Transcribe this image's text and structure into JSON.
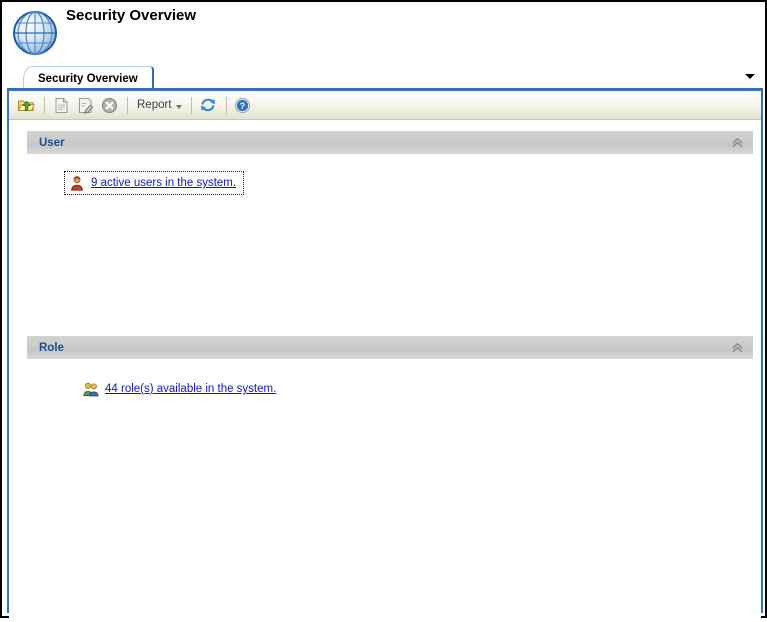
{
  "window": {
    "title": "Security Overview",
    "logo_icon": "globe-icon"
  },
  "tabs": [
    {
      "label": "Security Overview",
      "active": true
    }
  ],
  "tab_strip": {
    "overflow_icon": "chevron-down-icon"
  },
  "toolbar": {
    "buttons": [
      {
        "name": "go-up-button",
        "icon": "folder-up-arrow-icon",
        "label": "",
        "enabled": true
      },
      {
        "name": "new-button",
        "icon": "new-document-icon",
        "label": "",
        "enabled": false
      },
      {
        "name": "edit-button",
        "icon": "edit-document-icon",
        "label": "",
        "enabled": false
      },
      {
        "name": "delete-button",
        "icon": "delete-circle-icon",
        "label": "",
        "enabled": false
      }
    ],
    "report_menu": {
      "label": "Report",
      "caret_icon": "caret-down-icon"
    },
    "refresh_button": {
      "label": "",
      "icon": "refresh-icon"
    },
    "help_button": {
      "label": "",
      "icon": "help-question-icon"
    }
  },
  "sections": [
    {
      "id": "user",
      "title": "User",
      "collapse_icon": "double-chevron-up-icon",
      "item": {
        "icon": "single-user-icon",
        "text": "9 active users in the system.",
        "focused": true
      }
    },
    {
      "id": "role",
      "title": "Role",
      "collapse_icon": "double-chevron-up-icon",
      "item": {
        "icon": "user-group-icon",
        "text": "44 role(s) available in the system.",
        "focused": false
      }
    }
  ],
  "colors": {
    "frame": "#000000",
    "pane_border": "#3773b5",
    "tab_accent": "#2b6cb5",
    "section_title": "#1c4f8f",
    "link": "#1414cd"
  }
}
